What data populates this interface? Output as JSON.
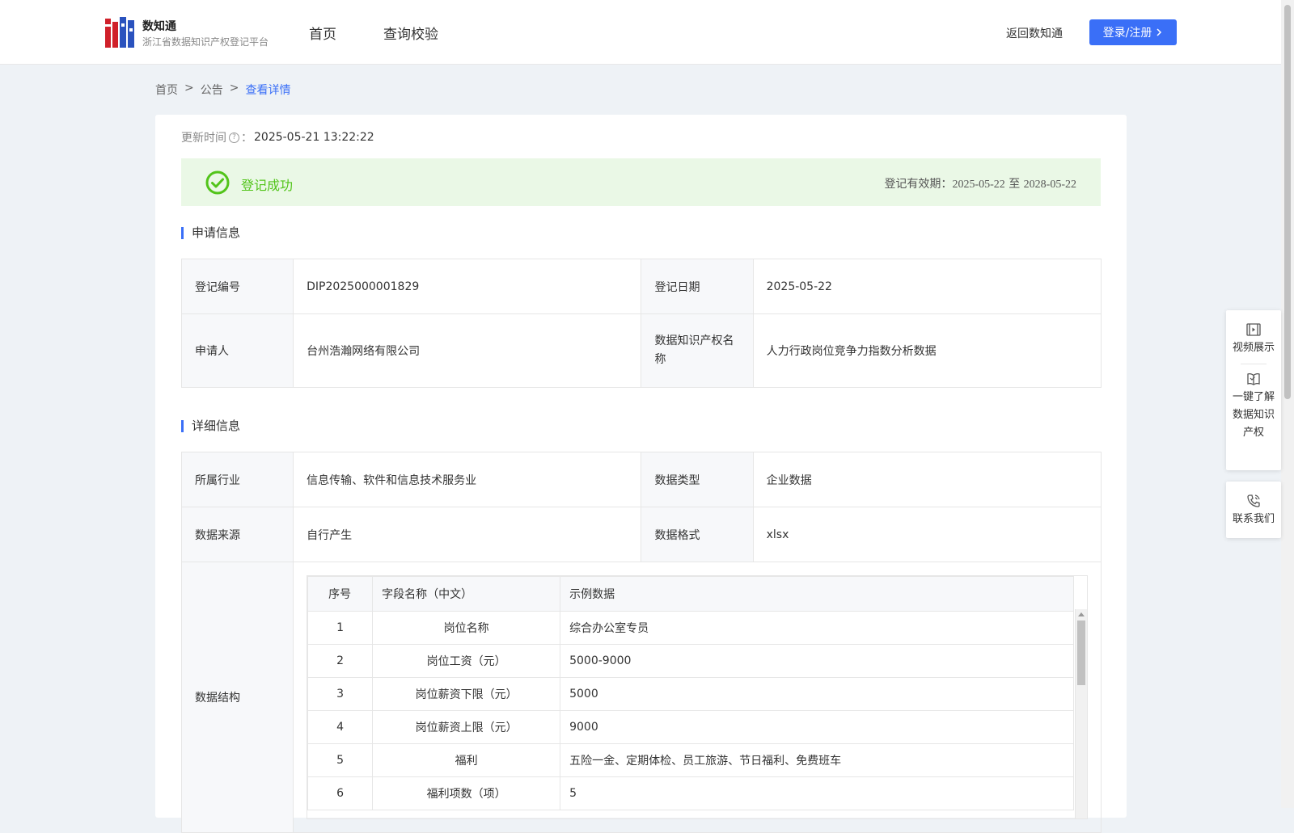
{
  "header": {
    "brand_name": "数知通",
    "brand_sub": "浙江省数据知识产权登记平台",
    "nav": [
      "首页",
      "查询校验"
    ],
    "back_link": "返回数知通",
    "login_label": "登录/注册"
  },
  "breadcrumb": [
    "首页",
    "公告",
    "查看详情"
  ],
  "update": {
    "label": "更新时间",
    "colon": "：",
    "value": "2025-05-21 13:22:22"
  },
  "status": {
    "text": "登记成功",
    "validity_label": "登记有效期：",
    "validity_start": "2025-05-22",
    "validity_sep": "至",
    "validity_end": "2028-05-22",
    "color": "#52c41a"
  },
  "application_info": {
    "title": "申请信息",
    "rows": [
      [
        {
          "label": "登记编号",
          "value": "DIP2025000001829"
        },
        {
          "label": "登记日期",
          "value": "2025-05-22"
        }
      ],
      [
        {
          "label": "申请人",
          "value": "台州浩瀚网络有限公司"
        },
        {
          "label": "数据知识产权名称",
          "value": "人力行政岗位竞争力指数分析数据"
        }
      ]
    ]
  },
  "detail_info": {
    "title": "详细信息",
    "rows": [
      [
        {
          "label": "所属行业",
          "value": "信息传输、软件和信息技术服务业"
        },
        {
          "label": "数据类型",
          "value": "企业数据"
        }
      ],
      [
        {
          "label": "数据来源",
          "value": "自行产生"
        },
        {
          "label": "数据格式",
          "value": "xlsx"
        }
      ]
    ],
    "structure_label": "数据结构",
    "structure_headers": [
      "序号",
      "字段名称（中文）",
      "示例数据"
    ],
    "structure_rows": [
      [
        "1",
        "岗位名称",
        "综合办公室专员"
      ],
      [
        "2",
        "岗位工资（元）",
        "5000-9000"
      ],
      [
        "3",
        "岗位薪资下限（元）",
        "5000"
      ],
      [
        "4",
        "岗位薪资上限（元）",
        "9000"
      ],
      [
        "5",
        "福利",
        "五险一金、定期体检、员工旅游、节日福利、免费班车"
      ],
      [
        "6",
        "福利项数（项）",
        "5"
      ]
    ]
  },
  "float_widgets": {
    "video": "视频展示",
    "learn": "一键了解数据知识产权",
    "contact": "联系我们"
  },
  "colors": {
    "accent": "#3a6ff7",
    "success_bg": "#eaf8e6",
    "page_bg": "#eef2f6"
  }
}
